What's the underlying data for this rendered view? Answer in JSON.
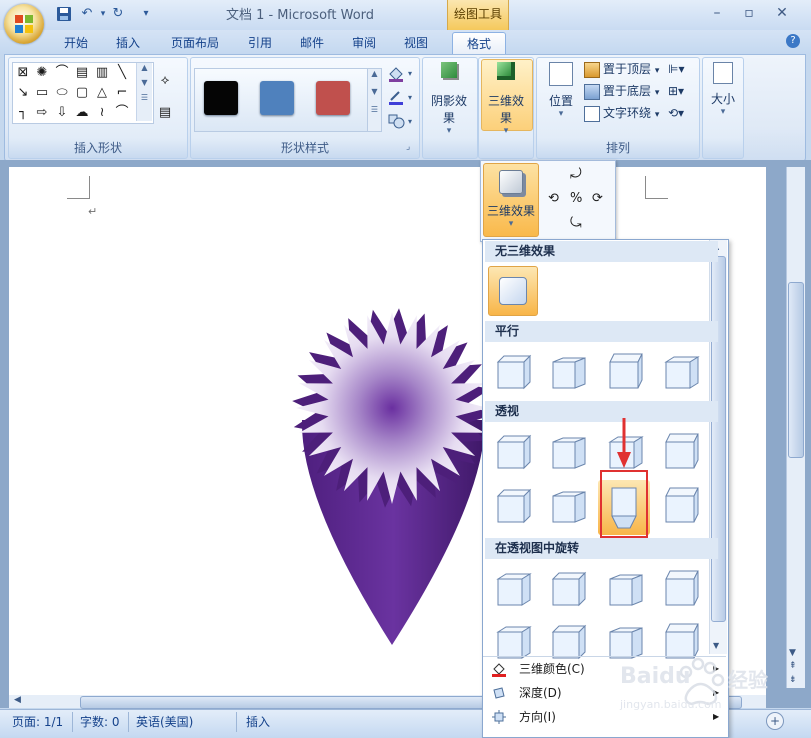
{
  "title_bar": {
    "document_title": "文档 1 - Microsoft Word",
    "context_tab_group": "绘图工具"
  },
  "tabs": [
    "开始",
    "插入",
    "页面布局",
    "引用",
    "邮件",
    "审阅",
    "视图",
    "格式"
  ],
  "active_tab": "格式",
  "ribbon": {
    "insert_shapes_label": "插入形状",
    "shape_styles_label": "形状样式",
    "shadow_effects_label": "阴影效果",
    "three_d_effects_label": "三维效果",
    "arrange_label": "排列",
    "position_label": "位置",
    "bring_to_front_label": "置于顶层",
    "send_to_back_label": "置于底层",
    "text_wrapping_label": "文字环绕",
    "size_label": "大小",
    "swatches": [
      {
        "color": "#050505"
      },
      {
        "color": "#4f81bd"
      },
      {
        "color": "#c0504d"
      }
    ]
  },
  "popup": {
    "three_d_effects_button": "三维效果"
  },
  "gallery": {
    "no_3d_header": "无三维效果",
    "parallel_header": "平行",
    "perspective_header": "透视",
    "rotation_header": "在透视图中旋转",
    "menu": {
      "color_label": "三维颜色(C)",
      "depth_label": "深度(D)",
      "direction_label": "方向(I)"
    }
  },
  "status_bar": {
    "page": "页面: 1/1",
    "words": "字数: 0",
    "language": "英语(美国)",
    "mode": "插入"
  },
  "watermark": {
    "brand": "Baidu",
    "subtitle": "经验",
    "url": "jingyan.baidu.com"
  }
}
